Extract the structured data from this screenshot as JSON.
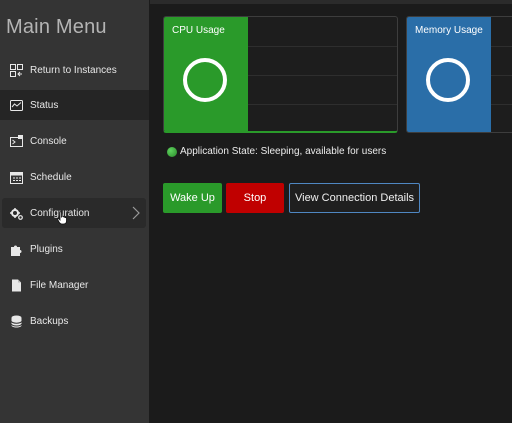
{
  "sidebar": {
    "title": "Main Menu",
    "items": [
      {
        "label": "Return to Instances",
        "icon": "return-icon"
      },
      {
        "label": "Status",
        "icon": "status-icon"
      },
      {
        "label": "Console",
        "icon": "console-icon"
      },
      {
        "label": "Schedule",
        "icon": "calendar-icon"
      },
      {
        "label": "Configuration",
        "icon": "gears-icon"
      },
      {
        "label": "Plugins",
        "icon": "puzzle-icon"
      },
      {
        "label": "File Manager",
        "icon": "file-icon"
      },
      {
        "label": "Backups",
        "icon": "database-icon"
      }
    ]
  },
  "cards": {
    "cpu": {
      "label": "CPU Usage",
      "color": "#2a9a2a"
    },
    "memory": {
      "label": "Memory Usage",
      "color": "#2a6ea8"
    }
  },
  "app_state": {
    "text": "Application State: Sleeping, available for users",
    "status_color": "#3fbf3f"
  },
  "buttons": {
    "wake": "Wake Up",
    "stop": "Stop",
    "details": "View Connection Details"
  }
}
